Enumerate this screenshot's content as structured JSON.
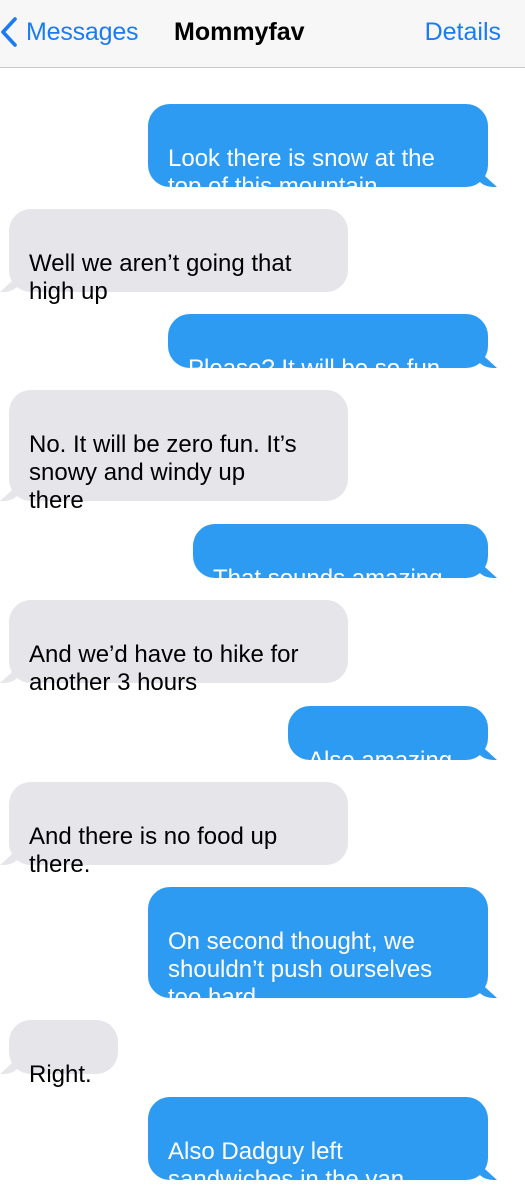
{
  "header": {
    "back_label": "Messages",
    "title": "Mommyfav",
    "details_label": "Details"
  },
  "messages": [
    {
      "from": "me",
      "text": "Look there is snow at the\ntop of this mountain"
    },
    {
      "from": "them",
      "text": "Well we aren’t going that\nhigh up"
    },
    {
      "from": "me",
      "text": "Please? It will be so fun"
    },
    {
      "from": "them",
      "text": "No. It will be zero fun. It’s\nsnowy and windy up\nthere"
    },
    {
      "from": "me",
      "text": "That sounds amazing"
    },
    {
      "from": "them",
      "text": "And we’d have to hike for\nanother 3 hours"
    },
    {
      "from": "me",
      "text": "Also amazing"
    },
    {
      "from": "them",
      "text": "And there is no food up\nthere."
    },
    {
      "from": "me",
      "text": "On second thought, we\nshouldn’t push ourselves\ntoo hard"
    },
    {
      "from": "them",
      "text": "Right."
    },
    {
      "from": "me",
      "text": "Also Dadguy left\nsandwiches in the van"
    }
  ],
  "colors": {
    "sent_bubble": "#2e9bf3",
    "received_bubble": "#e5e5ea",
    "accent": "#1a7cf5"
  }
}
